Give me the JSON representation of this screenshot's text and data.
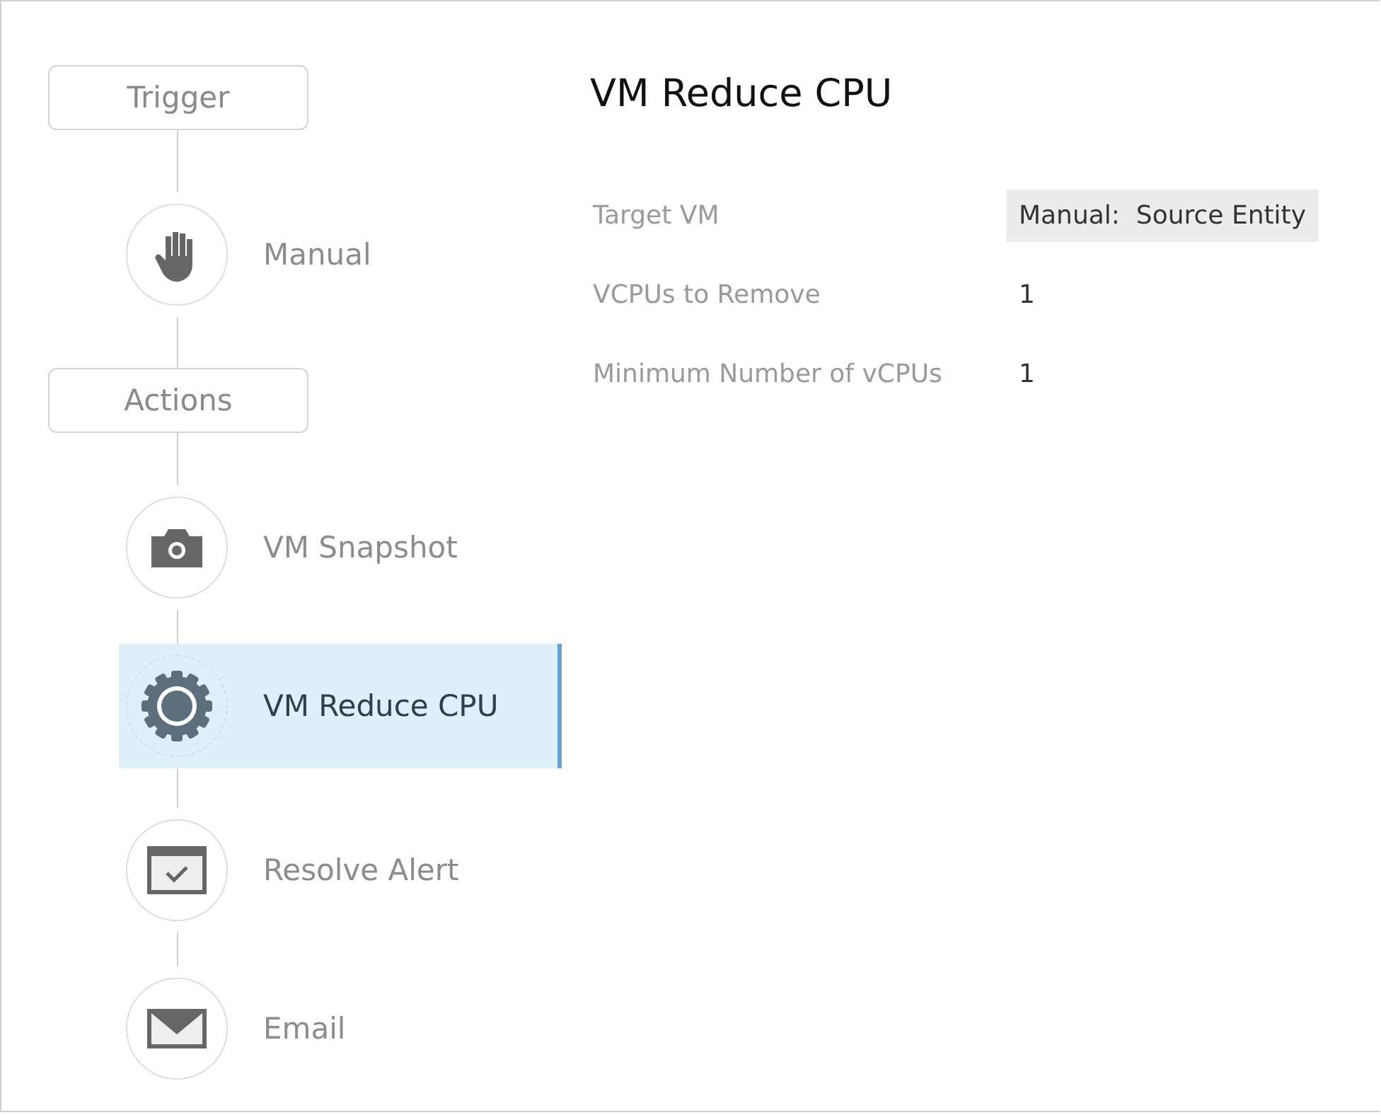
{
  "flow": [
    {
      "kind": "header",
      "label": "Trigger"
    },
    {
      "kind": "hand",
      "label": "Manual",
      "selected": false
    },
    {
      "kind": "header",
      "label": "Actions"
    },
    {
      "kind": "camera",
      "label": "VM Snapshot",
      "selected": false
    },
    {
      "kind": "gear",
      "label": "VM Reduce CPU",
      "selected": true
    },
    {
      "kind": "alert",
      "label": "Resolve Alert",
      "selected": false
    },
    {
      "kind": "mail",
      "label": "Email",
      "selected": false
    }
  ],
  "detail": {
    "title": "VM Reduce CPU",
    "fields": [
      {
        "label": "Target VM",
        "value": "Manual:  Source Entity",
        "kind": "chip"
      },
      {
        "label": "VCPUs to Remove",
        "value": "1",
        "kind": "plain"
      },
      {
        "label": "Minimum Number of vCPUs",
        "value": "1",
        "kind": "plain"
      }
    ]
  }
}
